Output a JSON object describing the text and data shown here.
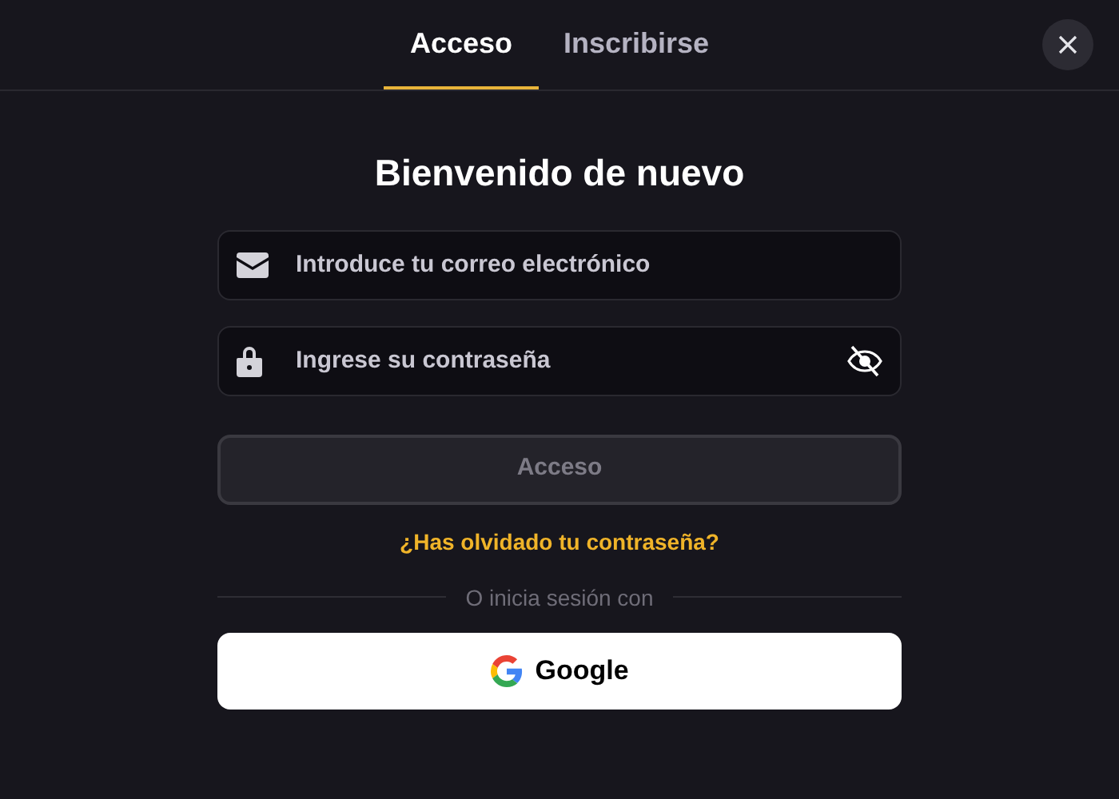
{
  "tabs": [
    {
      "label": "Acceso",
      "selected": true
    },
    {
      "label": "Inscribirse",
      "selected": false
    }
  ],
  "title": "Bienvenido de nuevo",
  "fields": [
    {
      "kind": "email",
      "placeholder": "Introduce tu correo electrónico"
    },
    {
      "kind": "password",
      "placeholder": "Ingrese su contraseña"
    }
  ],
  "submit": {
    "label": "Acceso",
    "disabled": true
  },
  "forgot_link": "¿Has olvidado tu contraseña?",
  "divider_text": "O inicia sesión con",
  "google_button": "Google"
}
